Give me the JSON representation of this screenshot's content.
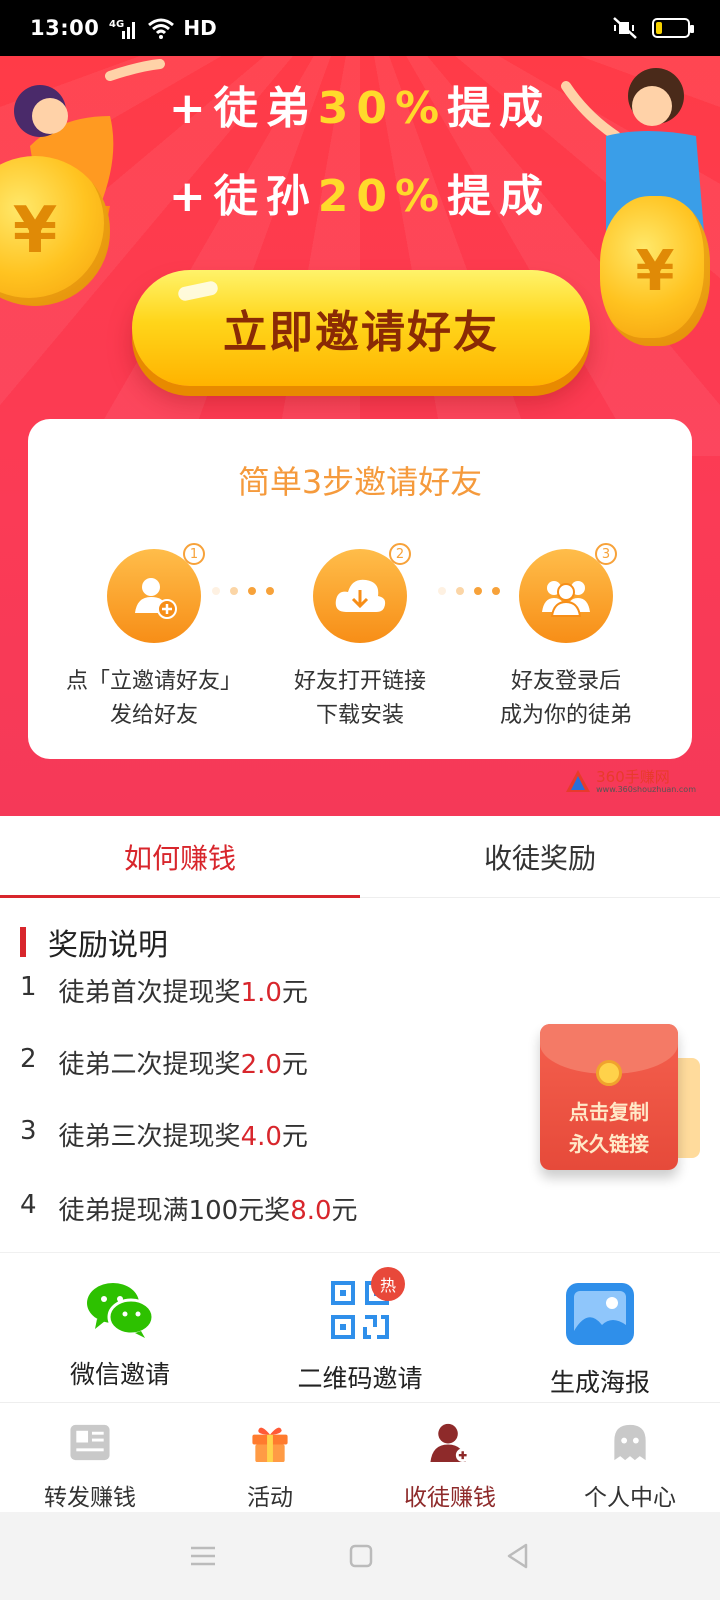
{
  "status_bar": {
    "time": "13:00",
    "network": "4G",
    "hd_label": "HD",
    "battery_level": 0.2
  },
  "hero": {
    "line1": {
      "prefix": "+徒弟",
      "value": "30%",
      "suffix": "提成"
    },
    "line2": {
      "prefix": "+徒孙",
      "value": "20%",
      "suffix": "提成"
    },
    "invite_button": "立即邀请好友"
  },
  "steps": {
    "title": "简单3步邀请好友",
    "items": [
      {
        "num": "1",
        "line1": "点「立邀请好友」",
        "line2": "发给好友",
        "icon": "add-user-icon"
      },
      {
        "num": "2",
        "line1": "好友打开链接",
        "line2": "下载安装",
        "icon": "cloud-download-icon"
      },
      {
        "num": "3",
        "line1": "好友登录后",
        "line2": "成为你的徒弟",
        "icon": "group-icon"
      }
    ]
  },
  "watermark": {
    "name": "360手赚网",
    "url": "www.360shouzhuan.com"
  },
  "tabs": [
    {
      "label": "如何赚钱",
      "active": true
    },
    {
      "label": "收徒奖励",
      "active": false
    }
  ],
  "rewards": {
    "title": "奖励说明",
    "items": [
      {
        "num": "1",
        "text": "徒弟首次提现奖",
        "amount": "1.0",
        "unit": "元"
      },
      {
        "num": "2",
        "text": "徒弟二次提现奖",
        "amount": "2.0",
        "unit": "元"
      },
      {
        "num": "3",
        "text": "徒弟三次提现奖",
        "amount": "4.0",
        "unit": "元"
      },
      {
        "num": "4",
        "text": "徒弟提现满100元奖",
        "amount": "8.0",
        "unit": "元"
      }
    ]
  },
  "red_packet": {
    "line1": "点击复制",
    "line2": "永久链接"
  },
  "invite_methods": [
    {
      "label": "微信邀请",
      "icon": "wechat-icon"
    },
    {
      "label": "二维码邀请",
      "icon": "qrcode-icon",
      "badge": "热"
    },
    {
      "label": "生成海报",
      "icon": "image-icon"
    }
  ],
  "bottom_nav": [
    {
      "label": "转发赚钱",
      "icon": "news-icon",
      "active": false
    },
    {
      "label": "活动",
      "icon": "gift-icon",
      "active": false
    },
    {
      "label": "收徒赚钱",
      "icon": "add-person-icon",
      "active": true
    },
    {
      "label": "个人中心",
      "icon": "ghost-icon",
      "active": false
    }
  ],
  "colors": {
    "hero_red": "#fb3b56",
    "highlight_yellow": "#ffd92b",
    "accent_orange": "#f59a3c",
    "active_red": "#d8262c",
    "wechat_green": "#2dc100",
    "qr_blue": "#2f8fea"
  }
}
